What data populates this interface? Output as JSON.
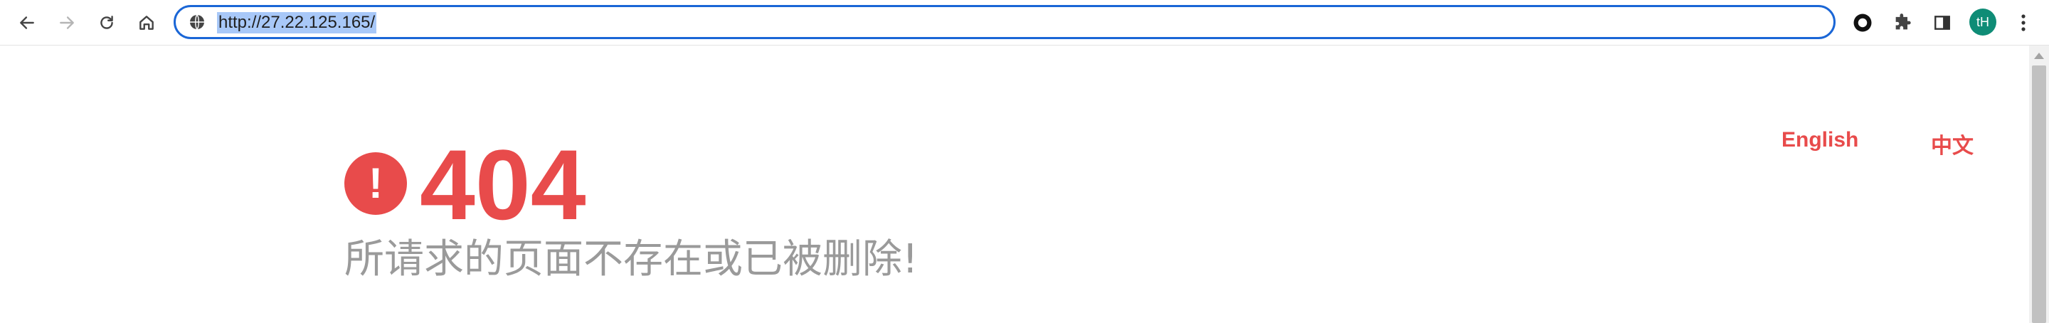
{
  "browser": {
    "url": "http://27.22.125.165/",
    "avatar_initials": "tH",
    "icons": {
      "back": "back-arrow-icon",
      "forward": "forward-arrow-icon",
      "reload": "reload-icon",
      "home": "home-icon",
      "site_info": "globe-icon",
      "extension_record": "record-icon",
      "extensions": "puzzle-icon",
      "side_panel": "side-panel-icon",
      "menu": "kebab-menu-icon"
    },
    "accent_color": "#1a66d6"
  },
  "page": {
    "languages": {
      "english": "English",
      "chinese": "中文"
    },
    "error": {
      "icon_symbol": "!",
      "code": "404",
      "message": "所请求的页面不存在或已被删除!"
    },
    "accent_color": "#e84b4b",
    "message_color": "#9a9a9a"
  }
}
